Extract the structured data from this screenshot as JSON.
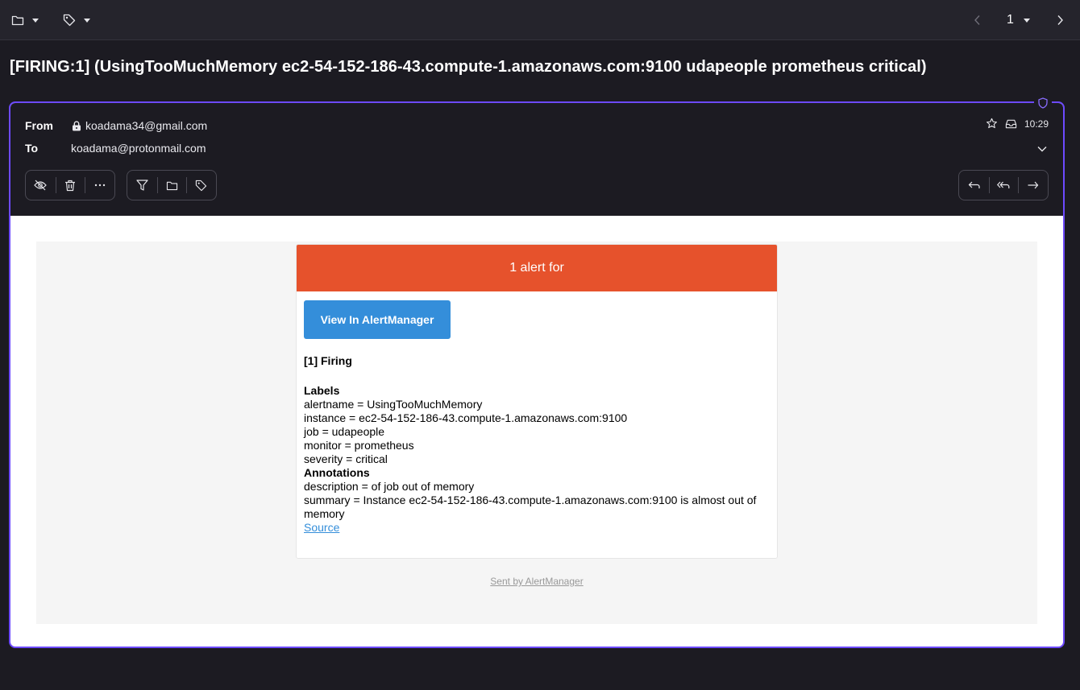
{
  "toolbar": {
    "move_icon": "folder-icon",
    "label_icon": "tag-icon",
    "page_number": "1"
  },
  "subject": "[FIRING:1] (UsingTooMuchMemory ec2-54-152-186-43.compute-1.amazonaws.com:9100 udapeople prometheus critical)",
  "header": {
    "from_label": "From",
    "from_value": "koadama34@gmail.com",
    "to_label": "To",
    "to_value": "koadama@protonmail.com",
    "time": "10:29"
  },
  "actions_left": [
    "mark-unread",
    "trash",
    "more"
  ],
  "actions_mid": [
    "filter",
    "move",
    "label"
  ],
  "actions_right": [
    "reply",
    "reply-all",
    "forward"
  ],
  "email": {
    "banner": "1 alert for",
    "button_label": "View In AlertManager",
    "firing_title": "[1] Firing",
    "labels_title": "Labels",
    "labels": [
      "alertname = UsingTooMuchMemory",
      "instance = ec2-54-152-186-43.compute-1.amazonaws.com:9100",
      "job = udapeople",
      "monitor = prometheus",
      "severity = critical"
    ],
    "annotations_title": "Annotations",
    "annotations": [
      "description = of job out of memory",
      "summary = Instance ec2-54-152-186-43.compute-1.amazonaws.com:9100 is almost out of memory"
    ],
    "source_link": "Source",
    "footer": "Sent by AlertManager"
  },
  "colors": {
    "accent": "#6d4aff",
    "alert_banner": "#e6522c",
    "button": "#348eda"
  }
}
